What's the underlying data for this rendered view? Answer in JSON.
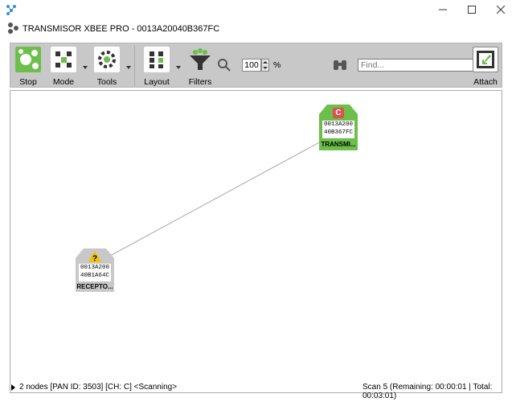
{
  "window": {
    "title": "TRANSMISOR XBEE PRO - 0013A20040B367FC",
    "controls": [
      "minimize-icon",
      "maximize-icon",
      "close-icon"
    ]
  },
  "toolbar": {
    "buttons": [
      {
        "label": "Stop",
        "icon": "network-scan-icon",
        "active": true
      },
      {
        "label": "Mode",
        "icon": "mode-grid-icon",
        "dropdown": true
      },
      {
        "label": "Tools",
        "icon": "gear-icon",
        "dropdown": true
      },
      {
        "label": "Layout",
        "icon": "layout-grid-icon",
        "dropdown": true
      },
      {
        "label": "Filters",
        "icon": "funnel-icon"
      },
      {
        "label": "Attach",
        "icon": "attach-window-icon"
      }
    ],
    "zoom_value": "100",
    "zoom_unit": "%",
    "find_placeholder": "Find..."
  },
  "nodes": [
    {
      "badge": "C",
      "address_line1": "0013A200",
      "address_line2": "40B367FC",
      "name": "TRANSMI...",
      "color": "#6dbf4b"
    },
    {
      "badge": "?",
      "address_line1": "0013A200",
      "address_line2": "40B1A64C",
      "name": "RECEPTO...",
      "color": "#c8c8c8"
    }
  ],
  "status": {
    "left": "2 nodes [PAN ID: 3503] [CH: C] <Scanning>",
    "right": "Scan 5 (Remaining: 00:00:01 | Total: 00:03:01)"
  },
  "colors": {
    "toolbar_bg": "#c8c8c8",
    "accent_green": "#6dbf4b",
    "coordinator_red": "#d9534f",
    "unknown_yellow": "#f2c200"
  }
}
